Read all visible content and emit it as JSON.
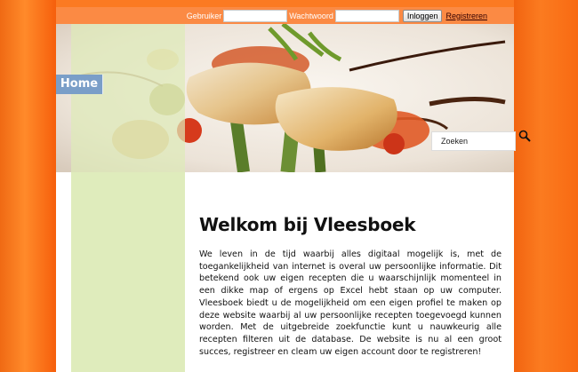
{
  "login": {
    "username_label": "Gebruiker",
    "password_label": "Wachtwoord",
    "username_value": "",
    "password_value": "",
    "login_button": "Inloggen",
    "register_link": "Registreren"
  },
  "nav": {
    "home_label": "Home"
  },
  "search": {
    "value": "Zoeken",
    "icon": "magnifier-icon"
  },
  "main": {
    "title": "Welkom bij Vleesboek",
    "intro": "We leven in de tijd waarbij alles digitaal mogelijk is, met de toegankelijkheid van internet is overal uw persoonlijke informatie. Dit betekend ook uw eigen recepten die u waarschijnlijk momenteel in een dikke map of ergens op Excel hebt staan op uw computer. Vleesboek biedt u de mogelijkheid om een eigen profiel te maken op deze website waarbij al uw persoonlijke recepten toegevoegd kunnen worden. Met de uitgebreide zoekfunctie kunt u nauwkeurig alle recepten filteren uit de database. De website is nu al een groot succes, registreer en cleam uw eigen account door te registreren!"
  },
  "colors": {
    "background_orange": "#f9641c",
    "login_bar": "#fb8a44",
    "side_column": "#dfecbc",
    "home_button": "#7a9ec8"
  }
}
